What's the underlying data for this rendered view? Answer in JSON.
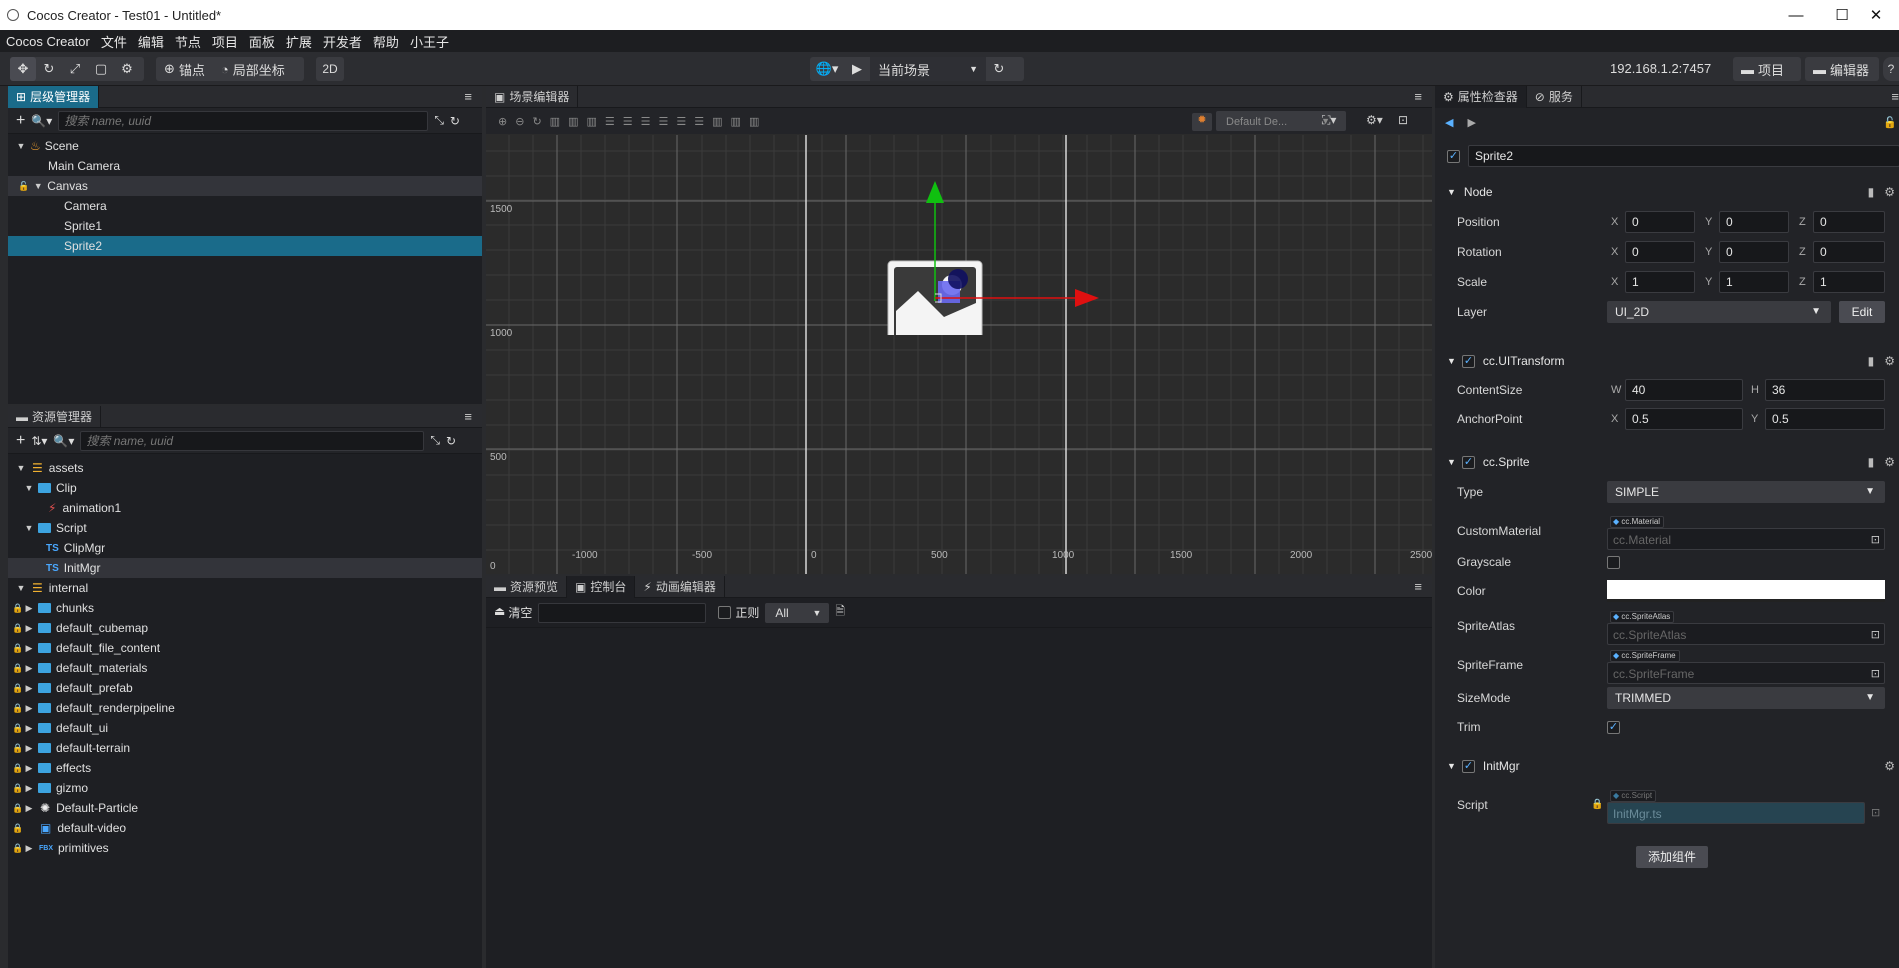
{
  "window": {
    "title": "Cocos Creator - Test01 - Untitled*",
    "minimize": "—",
    "maximize": "☐",
    "close": "✕"
  },
  "menu": [
    "Cocos Creator",
    "文件",
    "编辑",
    "节点",
    "项目",
    "面板",
    "扩展",
    "开发者",
    "帮助",
    "小王子"
  ],
  "toolbar": {
    "pivot_label": "锚点",
    "coord_label": "局部坐标",
    "mode_2d": "2D",
    "scene_select": "当前场景",
    "ip": "192.168.1.2:7457",
    "project_btn": "项目",
    "editor_btn": "编辑器"
  },
  "hierarchy": {
    "tab": "层级管理器",
    "search_placeholder": "搜索 name, uuid",
    "nodes": [
      {
        "label": "Scene"
      },
      {
        "label": "Main Camera"
      },
      {
        "label": "Canvas"
      },
      {
        "label": "Camera"
      },
      {
        "label": "Sprite1"
      },
      {
        "label": "Sprite2"
      }
    ]
  },
  "assets": {
    "tab": "资源管理器",
    "search_placeholder": "搜索 name, uuid",
    "items": [
      {
        "label": "assets"
      },
      {
        "label": "Clip"
      },
      {
        "label": "animation1"
      },
      {
        "label": "Script"
      },
      {
        "label": "ClipMgr",
        "tag": "TS"
      },
      {
        "label": "InitMgr",
        "tag": "TS"
      },
      {
        "label": "internal"
      },
      {
        "label": "chunks"
      },
      {
        "label": "default_cubemap"
      },
      {
        "label": "default_file_content"
      },
      {
        "label": "default_materials"
      },
      {
        "label": "default_prefab"
      },
      {
        "label": "default_renderpipeline"
      },
      {
        "label": "default_ui"
      },
      {
        "label": "default-terrain"
      },
      {
        "label": "effects"
      },
      {
        "label": "gizmo"
      },
      {
        "label": "Default-Particle"
      },
      {
        "label": "default-video"
      },
      {
        "label": "primitives",
        "tag": "FBX"
      }
    ]
  },
  "scene": {
    "tab": "场景编辑器",
    "layer_select": "Default De...",
    "y_labels": [
      "1500",
      "1000",
      "500",
      "0"
    ],
    "x_labels": [
      "-1000",
      "-500",
      "0",
      "500",
      "1000",
      "1500",
      "2000",
      "2500"
    ]
  },
  "console": {
    "tabs": [
      "资源预览",
      "控制台",
      "动画编辑器"
    ],
    "clear": "清空",
    "regex": "正则",
    "filter": "All"
  },
  "inspector": {
    "tabs": [
      "属性检查器",
      "服务"
    ],
    "node_name": "Sprite2",
    "node_section": "Node",
    "position": {
      "label": "Position",
      "x": "0",
      "y": "0",
      "z": "0"
    },
    "rotation": {
      "label": "Rotation",
      "x": "0",
      "y": "0",
      "z": "0"
    },
    "scale": {
      "label": "Scale",
      "x": "1",
      "y": "1",
      "z": "1"
    },
    "layer": {
      "label": "Layer",
      "value": "UI_2D",
      "edit": "Edit"
    },
    "uitransform": {
      "title": "cc.UITransform",
      "content_size_label": "ContentSize",
      "w": "40",
      "h": "36",
      "anchor_label": "AnchorPoint",
      "ax": "0.5",
      "ay": "0.5"
    },
    "sprite": {
      "title": "cc.Sprite",
      "type_label": "Type",
      "type_value": "SIMPLE",
      "material_label": "CustomMaterial",
      "material_tag": "cc.Material",
      "material_value": "cc.Material",
      "grayscale_label": "Grayscale",
      "color_label": "Color",
      "atlas_label": "SpriteAtlas",
      "atlas_tag": "cc.SpriteAtlas",
      "atlas_value": "cc.SpriteAtlas",
      "frame_label": "SpriteFrame",
      "frame_tag": "cc.SpriteFrame",
      "frame_value": "cc.SpriteFrame",
      "sizemode_label": "SizeMode",
      "sizemode_value": "TRIMMED",
      "trim_label": "Trim"
    },
    "initmgr": {
      "title": "InitMgr",
      "script_label": "Script",
      "script_tag": "cc.Script",
      "script_value": "InitMgr.ts"
    },
    "add_component": "添加组件"
  },
  "colors": {
    "accent": "#1a6b8a",
    "x_axis": "#e01010",
    "y_axis": "#10c010",
    "selection": "#1a6b8a"
  }
}
